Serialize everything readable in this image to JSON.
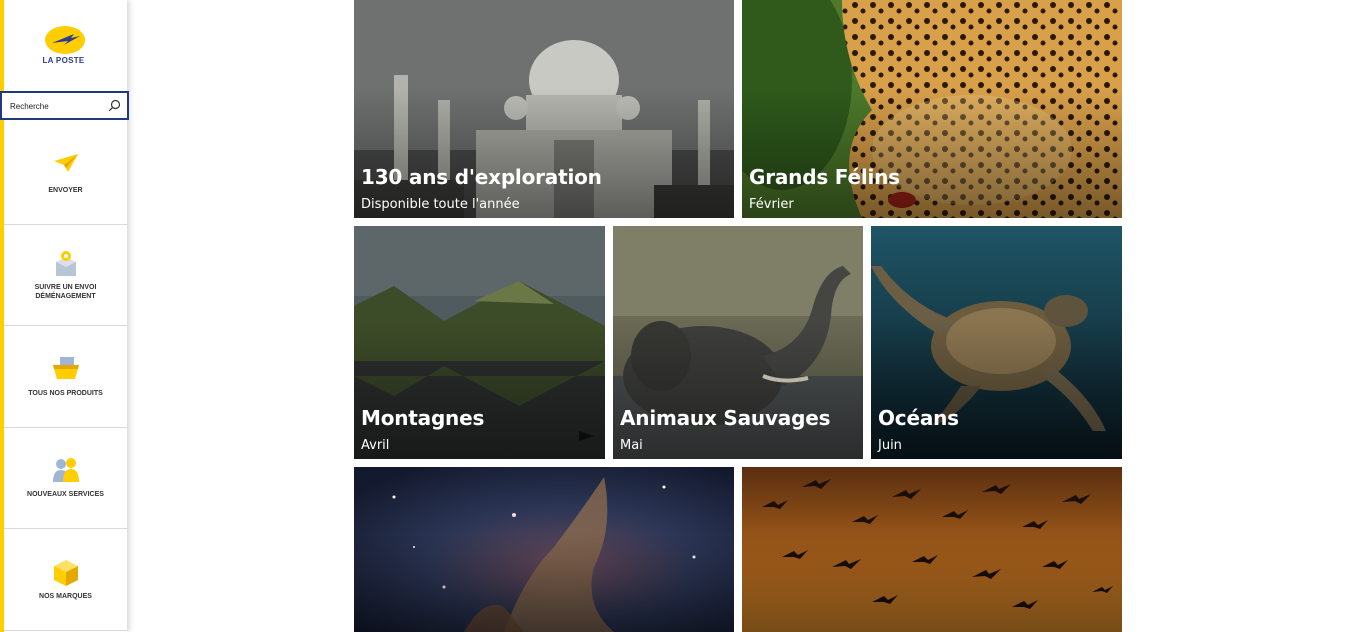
{
  "brand": {
    "logo_text": "LA POSTE"
  },
  "search": {
    "placeholder": "Recherche"
  },
  "sidebar": {
    "items": [
      {
        "label": "ENVOYER",
        "icon": "paper-plane-icon"
      },
      {
        "label_line1": "SUIVRE UN ENVOI",
        "label_line2": "DÉMÉNAGEMENT",
        "icon": "package-tracking-icon"
      },
      {
        "label": "TOUS NOS PRODUITS",
        "icon": "basket-icon"
      },
      {
        "label": "NOUVEAUX SERVICES",
        "icon": "people-icon"
      },
      {
        "label": "NOS MARQUES",
        "icon": "box-icon"
      }
    ]
  },
  "tiles": [
    {
      "title": "130 ans d'exploration",
      "subtitle": "Disponible toute l'année",
      "image": "taj-mahal"
    },
    {
      "title": "Grands Félins",
      "subtitle": "Février",
      "image": "leopard"
    },
    {
      "title": "Montagnes",
      "subtitle": "Avril",
      "image": "mountain-lake"
    },
    {
      "title": "Animaux Sauvages",
      "subtitle": "Mai",
      "image": "elephant"
    },
    {
      "title": "Océans",
      "subtitle": "Juin",
      "image": "sea-turtle"
    },
    {
      "title": "",
      "subtitle": "",
      "image": "nebula"
    },
    {
      "title": "",
      "subtitle": "",
      "image": "birds-sunset"
    }
  ],
  "colors": {
    "accent_yellow": "#ffcd00",
    "brand_blue": "#2e3c8c"
  }
}
